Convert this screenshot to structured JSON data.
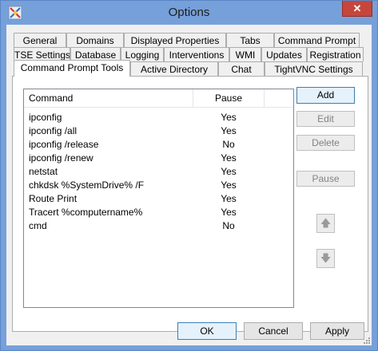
{
  "window": {
    "title": "Options",
    "close_glyph": "✕"
  },
  "tabs": {
    "row1": [
      "General",
      "Domains",
      "Displayed Properties",
      "Tabs",
      "Command Prompt"
    ],
    "row2": [
      "TSE Settings",
      "Database",
      "Logging",
      "Interventions",
      "WMI",
      "Updates",
      "Registration"
    ],
    "row3": [
      "Command Prompt Tools",
      "Active Directory",
      "Chat",
      "TightVNC Settings"
    ],
    "active": "Command Prompt Tools"
  },
  "list": {
    "columns": {
      "command": "Command",
      "pause": "Pause"
    },
    "rows": [
      {
        "command": "ipconfig",
        "pause": "Yes"
      },
      {
        "command": "ipconfig /all",
        "pause": "Yes"
      },
      {
        "command": "ipconfig /release",
        "pause": "No"
      },
      {
        "command": "ipconfig /renew",
        "pause": "Yes"
      },
      {
        "command": "netstat",
        "pause": "Yes"
      },
      {
        "command": "chkdsk %SystemDrive% /F",
        "pause": "Yes"
      },
      {
        "command": "Route Print",
        "pause": "Yes"
      },
      {
        "command": "Tracert %computername%",
        "pause": "Yes"
      },
      {
        "command": "cmd",
        "pause": "No"
      }
    ]
  },
  "side_buttons": {
    "add": "Add",
    "edit": "Edit",
    "delete": "Delete",
    "pause": "Pause"
  },
  "move_buttons": {
    "up_glyph": "🡅",
    "down_glyph": "🡇"
  },
  "footer": {
    "ok": "OK",
    "cancel": "Cancel",
    "apply": "Apply"
  },
  "colors": {
    "title_bar": "#76a0da",
    "close": "#c7463c",
    "default_button_border": "#3c7fb1"
  }
}
